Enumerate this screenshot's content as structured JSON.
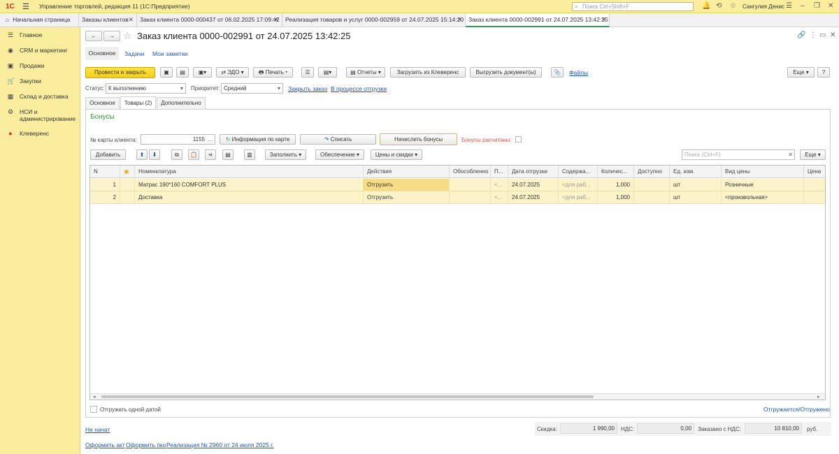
{
  "titlebar": {
    "logo": "1С",
    "title": "Управление торговлей, редакция 11  (1С:Предприятие)",
    "search_placeholder": "Поиск Ctrl+Shift+F",
    "user": "Сангулия Денис"
  },
  "tabs": [
    {
      "label": "Начальная страница"
    },
    {
      "label": "Заказы клиентов"
    },
    {
      "label": "Заказ клиента 0000-000437 от 06.02.2025 17:09:42"
    },
    {
      "label": "Реализация товаров и услуг 0000-002959 от 24.07.2025 15:14:20"
    },
    {
      "label": "Заказ клиента 0000-002991 от 24.07.2025 13:42:25"
    }
  ],
  "sidebar": {
    "items": [
      {
        "label": "Главное",
        "icon": "menu-icon"
      },
      {
        "label": "CRM и маркетинг",
        "icon": "crm-icon"
      },
      {
        "label": "Продажи",
        "icon": "sales-icon"
      },
      {
        "label": "Закупки",
        "icon": "purchases-icon"
      },
      {
        "label": "Склад и доставка",
        "icon": "warehouse-icon"
      },
      {
        "label": "НСИ и администрирование",
        "icon": "settings-icon"
      },
      {
        "label": "Клеверенс",
        "icon": "cleverence-icon"
      }
    ]
  },
  "doc": {
    "title": "Заказ клиента 0000-002991 от 24.07.2025 13:42:25",
    "subtabs": [
      "Основное",
      "Задачи",
      "Мои заметки"
    ]
  },
  "toolbar": {
    "post_close": "Провести и закрыть",
    "edo": "ЭДО",
    "print": "Печать",
    "reports": "Отчеты",
    "load_cleverence": "Загрузить из Клеверенс",
    "unload_docs": "Выгрузить документ(ы)",
    "files": "Файлы",
    "more": "Еще",
    "help": "?"
  },
  "status_row": {
    "status_label": "Статус:",
    "status_value": "К выполнению",
    "priority_label": "Приоритет:",
    "priority_value": "Средний",
    "close_order": "Закрыть заказ",
    "in_shipping": "В процессе отгрузки"
  },
  "form_tabs": [
    "Основное",
    "Товары (2)",
    "Дополнительно"
  ],
  "bonuses": {
    "title": "Бонусы",
    "card_label": "№  карты клиента:",
    "card_value": "1155",
    "card_info": "Информация по карте",
    "write_off": "Списать",
    "accrue": "Начислить бонусы",
    "calculated_label": "Бонусы расчитаны:"
  },
  "goods_toolbar": {
    "add": "Добавить",
    "fill": "Заполнить",
    "provision": "Обеспечение",
    "prices": "Цены и скидки",
    "search_placeholder": "Поиск (Ctrl+F)",
    "more": "Еще"
  },
  "table": {
    "columns": [
      "N",
      "",
      "Номенклатура",
      "Действия",
      "Обособленно",
      "П...",
      "Дата отгрузки",
      "Содержа...",
      "Количес...",
      "Доступно",
      "Ед. изм.",
      "Вид цены",
      "Цена"
    ],
    "rows": [
      {
        "n": "1",
        "item": "Матрас 190*160 COMFORT PLUS",
        "action": "Отгрузить",
        "separate": "",
        "p": "<...",
        "date": "24.07.2025",
        "content": "<для раб...",
        "qty": "1,000",
        "avail": "",
        "unit": "шт",
        "price_type": "Розничные",
        "price": ""
      },
      {
        "n": "2",
        "item": "Доставка",
        "action": "Отгрузить",
        "separate": "",
        "p": "<...",
        "date": "24.07.2025",
        "content": "<для раб...",
        "qty": "1,000",
        "avail": "",
        "unit": "шт",
        "price_type": "<произвольная>",
        "price": ""
      }
    ]
  },
  "footer": {
    "ship_one_date": "Отгружать одной датой",
    "shipped_status": "Отгружается/Отгружено",
    "not_started": "Не начат",
    "discount_label": "Скидка:",
    "discount_value": "1 990,00",
    "vat_label": "НДС:",
    "vat_value": "0,00",
    "ordered_label": "Заказано с НДС:",
    "ordered_value": "10 810,00",
    "currency": "руб.",
    "link_act": "Оформить акт",
    "link_pko": "Оформить пко",
    "link_realization": "Реализация № 2960 от 24 июля 2025 г."
  }
}
